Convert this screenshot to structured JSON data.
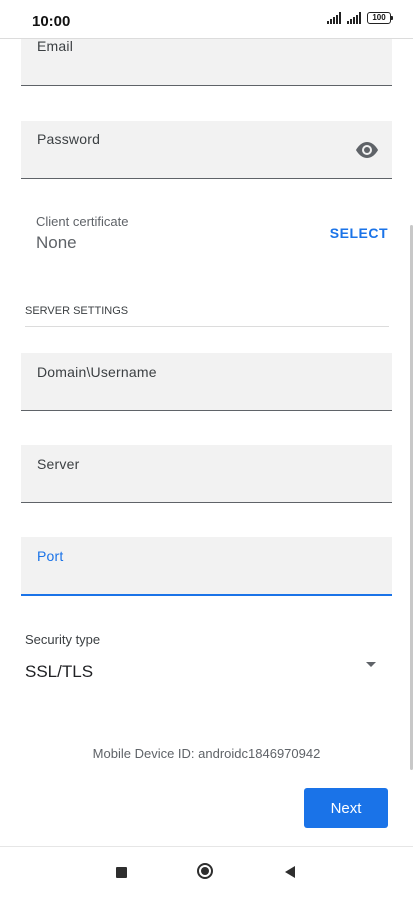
{
  "status_bar": {
    "time": "10:00",
    "battery": "100"
  },
  "form": {
    "email_label": "Email",
    "password_label": "Password",
    "client_certificate": {
      "label": "Client certificate",
      "value": "None",
      "select_label": "SELECT"
    },
    "server_settings_header": "SERVER SETTINGS",
    "domain_username_label": "Domain\\Username",
    "server_label": "Server",
    "port_label": "Port",
    "security_type": {
      "label": "Security type",
      "value": "SSL/TLS"
    }
  },
  "device_id_text": "Mobile Device ID: androidc1846970942",
  "next_label": "Next",
  "colors": {
    "accent": "#1a73e8",
    "field_bg": "#f2f2f2"
  }
}
